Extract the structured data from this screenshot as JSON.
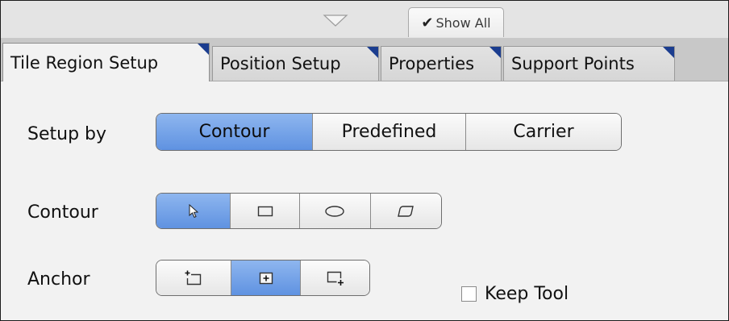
{
  "header": {
    "collapse_icon": "triangle-down-icon",
    "show_all": {
      "check_icon": "✔",
      "label": "Show All"
    }
  },
  "tabs": [
    {
      "label": "Tile Region Setup",
      "active": true
    },
    {
      "label": "Position Setup",
      "active": false
    },
    {
      "label": "Properties",
      "active": false
    },
    {
      "label": "Support Points",
      "active": false
    }
  ],
  "setup_by": {
    "label": "Setup by",
    "options": [
      "Contour",
      "Predefined",
      "Carrier"
    ],
    "selected": "Contour"
  },
  "contour": {
    "label": "Contour",
    "tools": [
      "pointer-icon",
      "rectangle-icon",
      "ellipse-icon",
      "polygon-icon"
    ],
    "selected": "pointer-icon",
    "keep_tool": {
      "label": "Keep Tool",
      "checked": false
    }
  },
  "anchor": {
    "label": "Anchor",
    "options": [
      "anchor-top-left-icon",
      "anchor-center-icon",
      "anchor-bottom-right-icon"
    ],
    "selected": "anchor-center-icon"
  },
  "colors": {
    "selection_blue": "#6b9be6",
    "tab_marker": "#1b3d8f",
    "tab_strip": "#c8c8c8"
  }
}
